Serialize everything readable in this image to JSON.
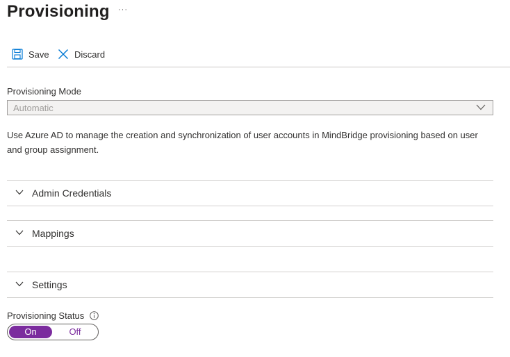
{
  "header": {
    "title": "Provisioning",
    "more_glyph": "···"
  },
  "toolbar": {
    "save_label": "Save",
    "discard_label": "Discard"
  },
  "provisioning_mode": {
    "label": "Provisioning Mode",
    "value": "Automatic"
  },
  "description": "Use Azure AD to manage the creation and synchronization of user accounts in MindBridge provisioning based on user and group assignment.",
  "sections": [
    {
      "title": "Admin Credentials"
    },
    {
      "title": "Mappings"
    },
    {
      "title": "Settings"
    }
  ],
  "provisioning_status": {
    "label": "Provisioning Status",
    "on_label": "On",
    "off_label": "Off",
    "selected": "On"
  },
  "colors": {
    "accent": "#7b2c9e",
    "link": "#0078d4"
  }
}
